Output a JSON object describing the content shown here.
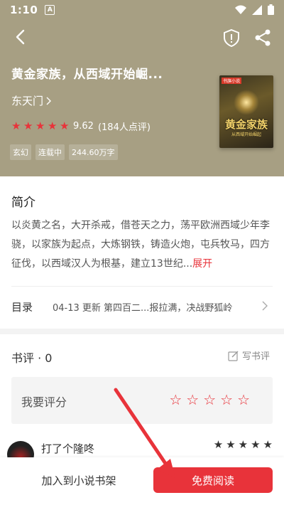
{
  "status_bar": {
    "time": "1:10",
    "badge": "A"
  },
  "book": {
    "title": "黄金家族，从西域开始崛...",
    "author": "东天门",
    "rating_score": "9.62",
    "rating_count": "(184人点评)",
    "stars": 5,
    "tags": [
      "玄幻",
      "连载中",
      "244.60万字"
    ],
    "cover_title": "黄金家族",
    "cover_subtitle": "从西域开始崛起",
    "cover_badge": "书旗小说"
  },
  "intro": {
    "heading": "简介",
    "text": "以炎黄之名，大开杀戒，借苍天之力，荡平欧洲西域少年李骁，以家族为起点，大炼钢铁，铸造火炮，屯兵牧马，四方征伐，以西域汉人为根基，建立13世纪...",
    "expand_label": "展开"
  },
  "toc": {
    "label": "目录",
    "latest": "04-13  更新  第四百二...报拉满，决战野狐岭"
  },
  "review": {
    "heading": "书评 · 0",
    "write_label": "写书评",
    "rate_label": "我要评分",
    "rate_stars": 5
  },
  "comment": {
    "user": "打了个隆咚",
    "stars": 5
  },
  "bottom": {
    "add_shelf": "加入到小说书架",
    "read": "免费阅读"
  },
  "colors": {
    "accent": "#e8333a",
    "hero_bg": "#a79f83"
  }
}
